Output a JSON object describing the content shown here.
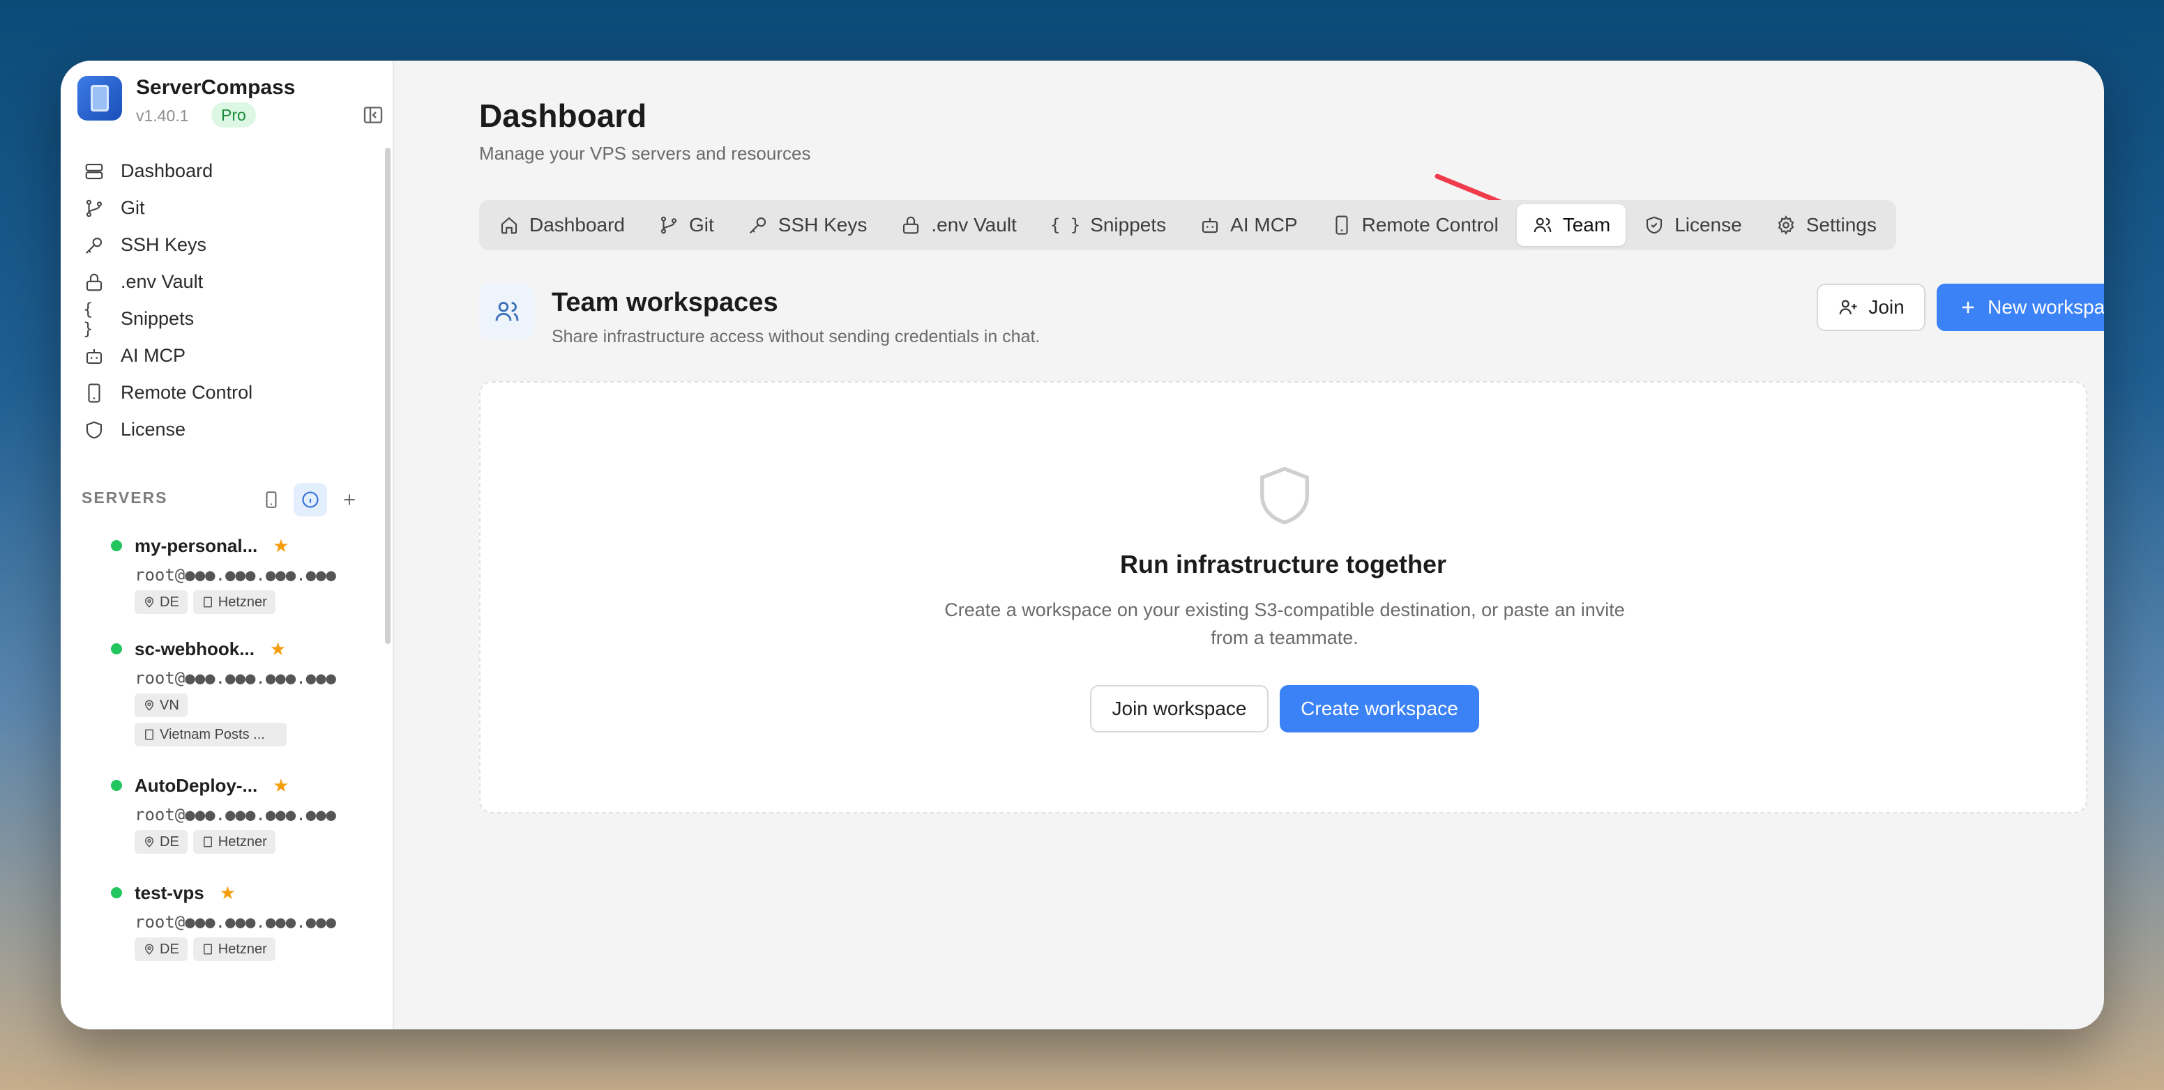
{
  "app": {
    "name": "ServerCompass",
    "version": "v1.40.1",
    "plan_badge": "Pro"
  },
  "sidebar": {
    "items": [
      {
        "label": "Dashboard",
        "icon": "server-stack-icon"
      },
      {
        "label": "Git",
        "icon": "git-branch-icon"
      },
      {
        "label": "SSH Keys",
        "icon": "key-icon"
      },
      {
        "label": ".env Vault",
        "icon": "lock-icon"
      },
      {
        "label": "Snippets",
        "icon": "braces-icon"
      },
      {
        "label": "AI MCP",
        "icon": "bot-icon"
      },
      {
        "label": "Remote Control",
        "icon": "smartphone-icon"
      },
      {
        "label": "License",
        "icon": "shield-icon"
      }
    ],
    "servers_label": "SERVERS",
    "servers": [
      {
        "name": "my-personal...",
        "ip": "root@●●●.●●●.●●●.●●●",
        "tags": [
          "DE",
          "Hetzner"
        ]
      },
      {
        "name": "sc-webhook...",
        "ip": "root@●●●.●●●.●●●.●●●",
        "tags": [
          "VN",
          "Vietnam Posts ..."
        ]
      },
      {
        "name": "AutoDeploy-...",
        "ip": "root@●●●.●●●.●●●.●●●",
        "tags": [
          "DE",
          "Hetzner"
        ]
      },
      {
        "name": "test-vps",
        "ip": "root@●●●.●●●.●●●.●●●",
        "tags": [
          "DE",
          "Hetzner"
        ]
      }
    ]
  },
  "header": {
    "title": "Dashboard",
    "subtitle": "Manage your VPS servers and resources"
  },
  "tabs": [
    {
      "label": "Dashboard",
      "icon": "home-icon"
    },
    {
      "label": "Git",
      "icon": "git-branch-icon"
    },
    {
      "label": "SSH Keys",
      "icon": "key-icon"
    },
    {
      "label": ".env Vault",
      "icon": "lock-icon"
    },
    {
      "label": "Snippets",
      "icon": "braces-icon"
    },
    {
      "label": "AI MCP",
      "icon": "bot-icon"
    },
    {
      "label": "Remote Control",
      "icon": "smartphone-icon"
    },
    {
      "label": "Team",
      "icon": "users-icon",
      "active": true
    },
    {
      "label": "License",
      "icon": "shield-check-icon"
    },
    {
      "label": "Settings",
      "icon": "gear-icon"
    }
  ],
  "team": {
    "title": "Team workspaces",
    "subtitle": "Share infrastructure access without sending credentials in chat.",
    "join_label": "Join",
    "new_label": "New workspace",
    "empty_title": "Run infrastructure together",
    "empty_desc": "Create a workspace on your existing S3-compatible destination, or paste an invite from a teammate.",
    "join_workspace_label": "Join workspace",
    "create_workspace_label": "Create workspace"
  },
  "colors": {
    "accent": "#3b82f6",
    "status_online": "#22c55e",
    "favorite": "#f59e0b",
    "annotation_arrow": "#ef3b4a"
  }
}
